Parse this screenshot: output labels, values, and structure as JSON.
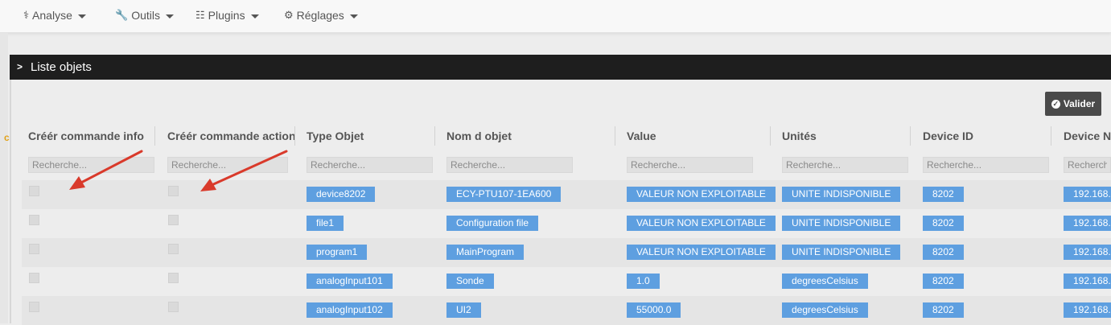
{
  "nav": [
    {
      "icon": "stethoscope-icon",
      "glyph": "⚕",
      "label": "Analyse"
    },
    {
      "icon": "wrench-icon",
      "glyph": "🔧",
      "label": "Outils"
    },
    {
      "icon": "tasks-icon",
      "glyph": "☷",
      "label": "Plugins"
    },
    {
      "icon": "gear-icon",
      "glyph": "⚙",
      "label": "Réglages"
    }
  ],
  "panel": {
    "title": "Liste objets"
  },
  "valider_label": "Valider",
  "columns": [
    "Créér commande info",
    "Créér commande action",
    "Type Objet",
    "Nom d objet",
    "Value",
    "Unités",
    "Device ID",
    "Device Ne"
  ],
  "search_placeholder": "Recherche...",
  "rows": [
    [
      "device8202",
      "ECY-PTU107-1EA600",
      "VALEUR NON EXPLOITABLE",
      "UNITE INDISPONIBLE",
      "8202",
      "192.168."
    ],
    [
      "file1",
      "Configuration file",
      "VALEUR NON EXPLOITABLE",
      "UNITE INDISPONIBLE",
      "8202",
      "192.168."
    ],
    [
      "program1",
      "MainProgram",
      "VALEUR NON EXPLOITABLE",
      "UNITE INDISPONIBLE",
      "8202",
      "192.168."
    ],
    [
      "analogInput101",
      "Sonde",
      "1.0",
      "degreesCelsius",
      "8202",
      "192.168."
    ],
    [
      "analogInput102",
      "UI2",
      "55000.0",
      "degreesCelsius",
      "8202",
      "192.168."
    ]
  ],
  "colors": {
    "tag": "#5e9fe0",
    "arrow": "#d93a2b",
    "header": "#1e1e1e"
  }
}
